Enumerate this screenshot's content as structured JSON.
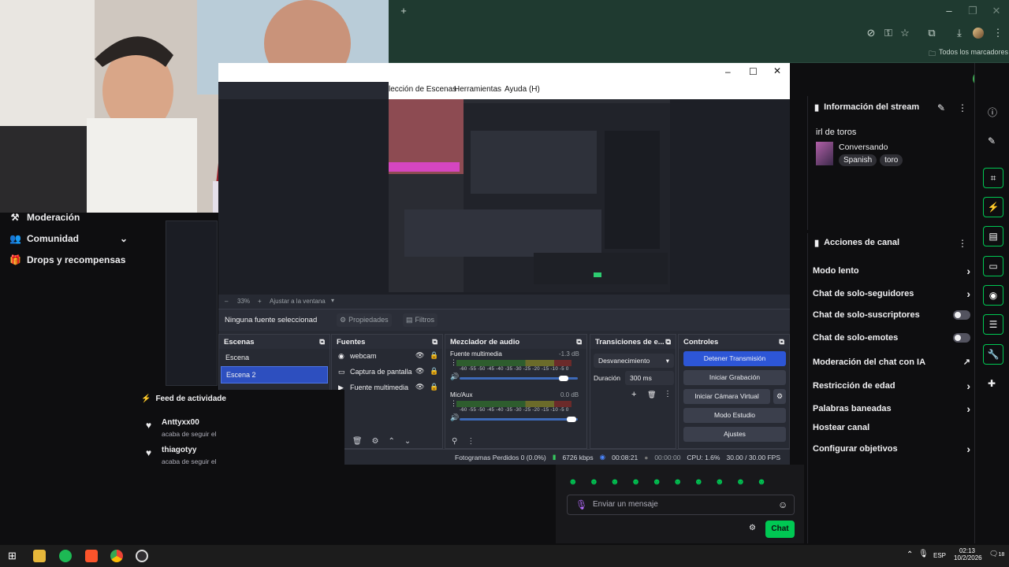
{
  "browser": {
    "new_tab": "+",
    "bookmarks_label": "Todos los marcadores"
  },
  "obs": {
    "menu": [
      "lección de Escenas",
      "Herramientas",
      "Ayuda (H)"
    ],
    "zoom": "33%",
    "fit_label": "Ajustar a la ventana",
    "no_source": "Ninguna fuente seleccionad",
    "properties": "Propiedades",
    "filters": "Filtros",
    "scenes_title": "Escenas",
    "scenes": [
      "Escena",
      "Escena 2"
    ],
    "sources_title": "Fuentes",
    "sources": [
      "webcam",
      "Captura de pantalla",
      "Fuente multimedia"
    ],
    "mixer_title": "Mezclador de audio",
    "mixer": [
      {
        "name": "Fuente multimedia",
        "db": "-1.3 dB",
        "level": 0.9
      },
      {
        "name": "Mic/Aux",
        "db": "0.0 dB",
        "level": 0.95
      }
    ],
    "meter_scale": "-60 -55 -50 -45 -40 -35 -30 -25 -20 -15 -10 -5 0",
    "transitions_title": "Transiciones de e...",
    "transition_select": "Desvanecimiento",
    "duration_label": "Duración",
    "duration_value": "300 ms",
    "controls_title": "Controles",
    "controls": [
      "Detener Transmisión",
      "Iniciar Grabación",
      "Iniciar Cámara Virtual",
      "Modo Estudio",
      "Ajustes"
    ],
    "status": {
      "dropped": "Fotogramas Perdidos 0 (0.0%)",
      "kbps": "6726 kbps",
      "live_time": "00:08:21",
      "rec_time": "00:00:00",
      "cpu": "CPU: 1.6%",
      "fps": "30.00 / 30.00 FPS"
    }
  },
  "twitch": {
    "nav": [
      "Moderación",
      "Comunidad",
      "Drops y recompensas"
    ],
    "stream_info_title": "Información del stream",
    "stream_title": "irl de toros",
    "category": "Conversando",
    "tags": [
      "Spanish",
      "toro"
    ],
    "channel_actions_title": "Acciones de canal",
    "actions": [
      {
        "label": "Modo lento",
        "kind": "chevron"
      },
      {
        "label": "Chat de solo-seguidores",
        "kind": "chevron"
      },
      {
        "label": "Chat de solo-suscriptores",
        "kind": "toggle"
      },
      {
        "label": "Chat de solo-emotes",
        "kind": "toggle"
      },
      {
        "label": "Moderación del chat con IA",
        "kind": "external"
      },
      {
        "label": "Restricción de edad",
        "kind": "chevron"
      },
      {
        "label": "Palabras baneadas",
        "kind": "chevron"
      },
      {
        "label": "Hostear canal",
        "kind": "none"
      },
      {
        "label": "Configurar objetivos",
        "kind": "chevron"
      }
    ],
    "feed_title": "Feed de actividade",
    "feed": [
      {
        "user": "Anttyxx00",
        "text": "acaba de seguir el"
      },
      {
        "user": "thiagotyy",
        "text": "acaba de seguir el"
      }
    ],
    "chat_placeholder": "Enviar un mensaje",
    "chat_button": "Chat"
  },
  "taskbar": {
    "lang": "ESP",
    "time": "02:13",
    "date": "10/2/2026",
    "notif": "18"
  }
}
